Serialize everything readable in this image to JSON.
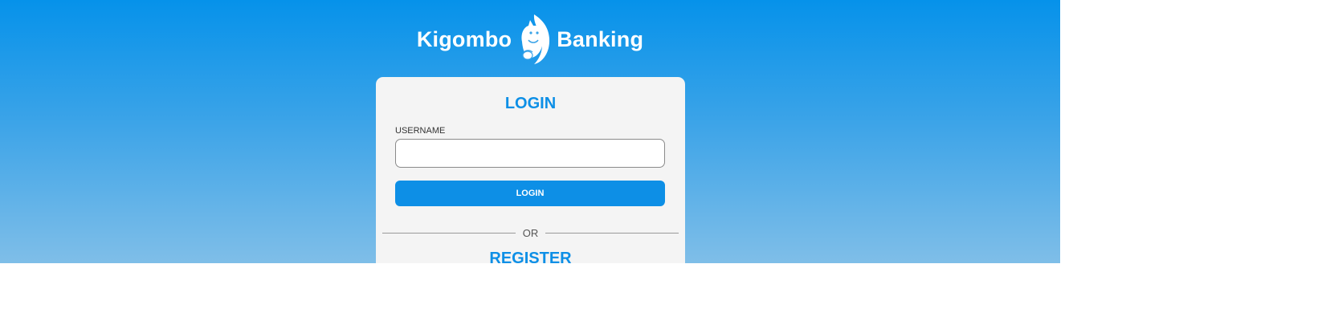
{
  "brand": {
    "name_left": "Kigombo",
    "name_right": "Banking",
    "logo_icon": "squirrel-logo-icon",
    "logo_color": "#ffffff"
  },
  "colors": {
    "background_top": "#0692ea",
    "background_bottom": "#7fbee8",
    "accent": "#0d8fe6",
    "card": "#f4f4f4"
  },
  "login": {
    "title": "LOGIN",
    "username_label": "USERNAME",
    "username_value": "",
    "button_label": "LOGIN"
  },
  "divider": {
    "text": "OR"
  },
  "register": {
    "title": "REGISTER"
  }
}
